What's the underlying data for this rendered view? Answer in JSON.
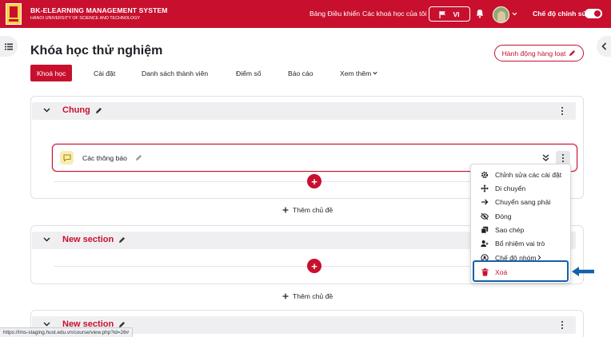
{
  "header": {
    "brand_title": "BK-ELEARNING MANAGEMENT SYSTEM",
    "brand_subtitle": "HANOI UNIVERSITY OF SCIENCE AND TECHNOLOGY",
    "nav_dashboard": "Bảng Điều khiển",
    "nav_my_courses": "Các khoá học của tôi",
    "language": "VI",
    "edit_mode_label": "Chế độ chỉnh sửa",
    "edit_mode_on": true,
    "accent_color": "#c8102e"
  },
  "page": {
    "title": "Khóa học thử nghiệm",
    "bulk_actions": "Hành động hàng loạt"
  },
  "tabs": [
    {
      "label": "Khoá học",
      "active": true
    },
    {
      "label": "Cài đặt",
      "active": false
    },
    {
      "label": "Danh sách thành viên",
      "active": false
    },
    {
      "label": "Điểm số",
      "active": false
    },
    {
      "label": "Báo cáo",
      "active": false
    },
    {
      "label": "Xem thêm",
      "active": false
    }
  ],
  "sections": [
    {
      "title": "Chung",
      "activity": "Các thông báo",
      "add_section": "Thêm chủ đề"
    },
    {
      "title": "New section",
      "add_section": "Thêm chủ đề"
    },
    {
      "title": "New section"
    }
  ],
  "menu": [
    {
      "label": "Chỉnh sửa các cài đặt",
      "icon": "gear-icon"
    },
    {
      "label": "Di chuyển",
      "icon": "move-icon"
    },
    {
      "label": "Chuyển sang phải",
      "icon": "arrow-right-icon"
    },
    {
      "label": "Đóng",
      "icon": "eye-slash-icon"
    },
    {
      "label": "Sao chép",
      "icon": "copy-icon"
    },
    {
      "label": "Bổ nhiệm vai trò",
      "icon": "user-plus-icon"
    },
    {
      "label": "Chế độ nhóm",
      "icon": "group-mode-icon"
    },
    {
      "label": "Xoá",
      "icon": "trash-icon",
      "danger": true
    }
  ],
  "highlight_color": "#1560a8",
  "status_url": "https://lms-staging.hust.edu.vn/course/view.php?id=26#"
}
